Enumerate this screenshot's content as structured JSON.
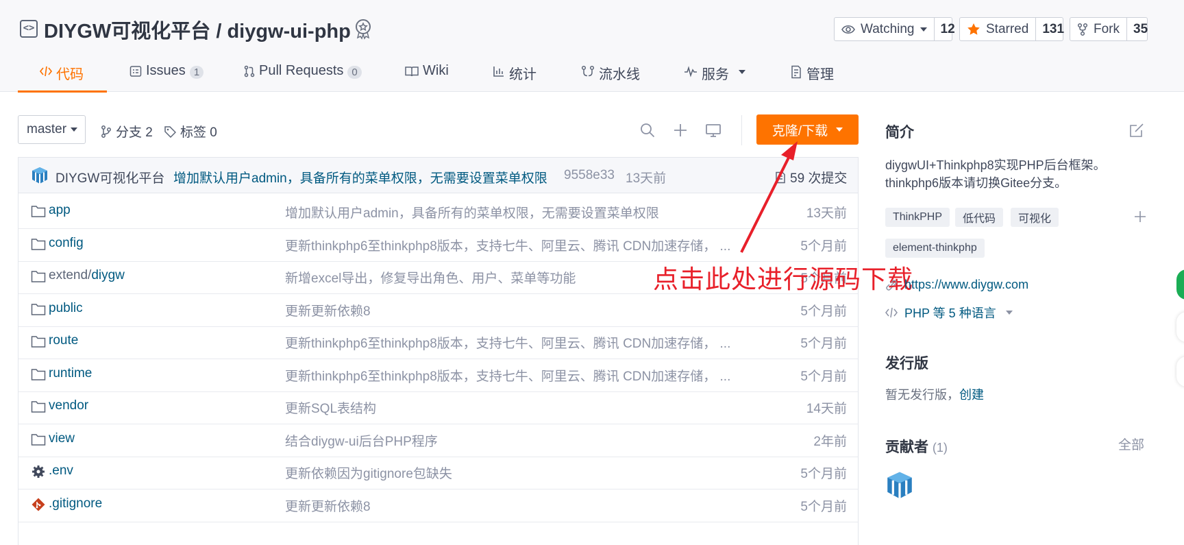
{
  "repo": {
    "title": "DIYGW可视化平台 / diygw-ui-php"
  },
  "counters": {
    "watch": {
      "label": "Watching",
      "count": "12"
    },
    "star": {
      "label": "Starred",
      "count": "131"
    },
    "fork": {
      "label": "Fork",
      "count": "35"
    }
  },
  "tabs": [
    {
      "label": "代码",
      "count": ""
    },
    {
      "label": "Issues",
      "count": "1"
    },
    {
      "label": "Pull Requests",
      "count": "0"
    },
    {
      "label": "Wiki",
      "count": ""
    },
    {
      "label": "统计",
      "count": ""
    },
    {
      "label": "流水线",
      "count": ""
    },
    {
      "label": "服务",
      "count": ""
    },
    {
      "label": "管理",
      "count": ""
    }
  ],
  "toolbar": {
    "branch": "master",
    "branches": "分支 2",
    "tags": "标签 0",
    "clone_label": "克隆/下载"
  },
  "commit": {
    "author": "DIYGW可视化平台",
    "message": "增加默认用户admin，具备所有的菜单权限，无需要设置菜单权限",
    "sha": "9558e33",
    "time": "13天前",
    "count": "59 次提交"
  },
  "files": [
    {
      "type": "folder",
      "name": "app",
      "prefix": "",
      "message": "增加默认用户admin，具备所有的菜单权限，无需要设置菜单权限",
      "time": "13天前"
    },
    {
      "type": "folder",
      "name": "config",
      "prefix": "",
      "message": "更新thinkphp6至thinkphp8版本，支持七牛、阿里云、腾讯 CDN加速存储， ...",
      "time": "5个月前"
    },
    {
      "type": "folder",
      "name": "diygw",
      "prefix": "extend/",
      "message": "新增excel导出，修复导出角色、用户、菜单等功能",
      "time": "5个月前"
    },
    {
      "type": "folder",
      "name": "public",
      "prefix": "",
      "message": "更新更新依赖8",
      "time": "5个月前"
    },
    {
      "type": "folder",
      "name": "route",
      "prefix": "",
      "message": "更新thinkphp6至thinkphp8版本，支持七牛、阿里云、腾讯 CDN加速存储， ...",
      "time": "5个月前"
    },
    {
      "type": "folder",
      "name": "runtime",
      "prefix": "",
      "message": "更新thinkphp6至thinkphp8版本，支持七牛、阿里云、腾讯 CDN加速存储， ...",
      "time": "5个月前"
    },
    {
      "type": "folder",
      "name": "vendor",
      "prefix": "",
      "message": "更新SQL表结构",
      "time": "14天前"
    },
    {
      "type": "folder",
      "name": "view",
      "prefix": "",
      "message": "结合diygw-ui后台PHP程序",
      "time": "2年前"
    },
    {
      "type": "config",
      "name": ".env",
      "prefix": "",
      "message": "更新依赖因为gitignore包缺失",
      "time": "5个月前"
    },
    {
      "type": "git",
      "name": ".gitignore",
      "prefix": "",
      "message": "更新更新依赖8",
      "time": "5个月前"
    }
  ],
  "annotation": "点击此处进行源码下载",
  "sidebar": {
    "intro_title": "简介",
    "intro_line1": "diygwUI+Thinkphp8实现PHP后台框架。",
    "intro_line2": "thinkphp6版本请切换Gitee分支。",
    "tags": [
      "ThinkPHP",
      "低代码",
      "可视化",
      "element-thinkphp"
    ],
    "website": "https://www.diygw.com",
    "languages": "PHP 等 5 种语言",
    "release_title": "发行版",
    "release_text": "暂无发行版，",
    "release_link": "创建",
    "contrib_title": "贡献者",
    "contrib_count": "(1)",
    "contrib_all": "全部"
  },
  "colors": {
    "accent": "#fe7300",
    "link": "#005980",
    "annotation": "#e8202a"
  }
}
